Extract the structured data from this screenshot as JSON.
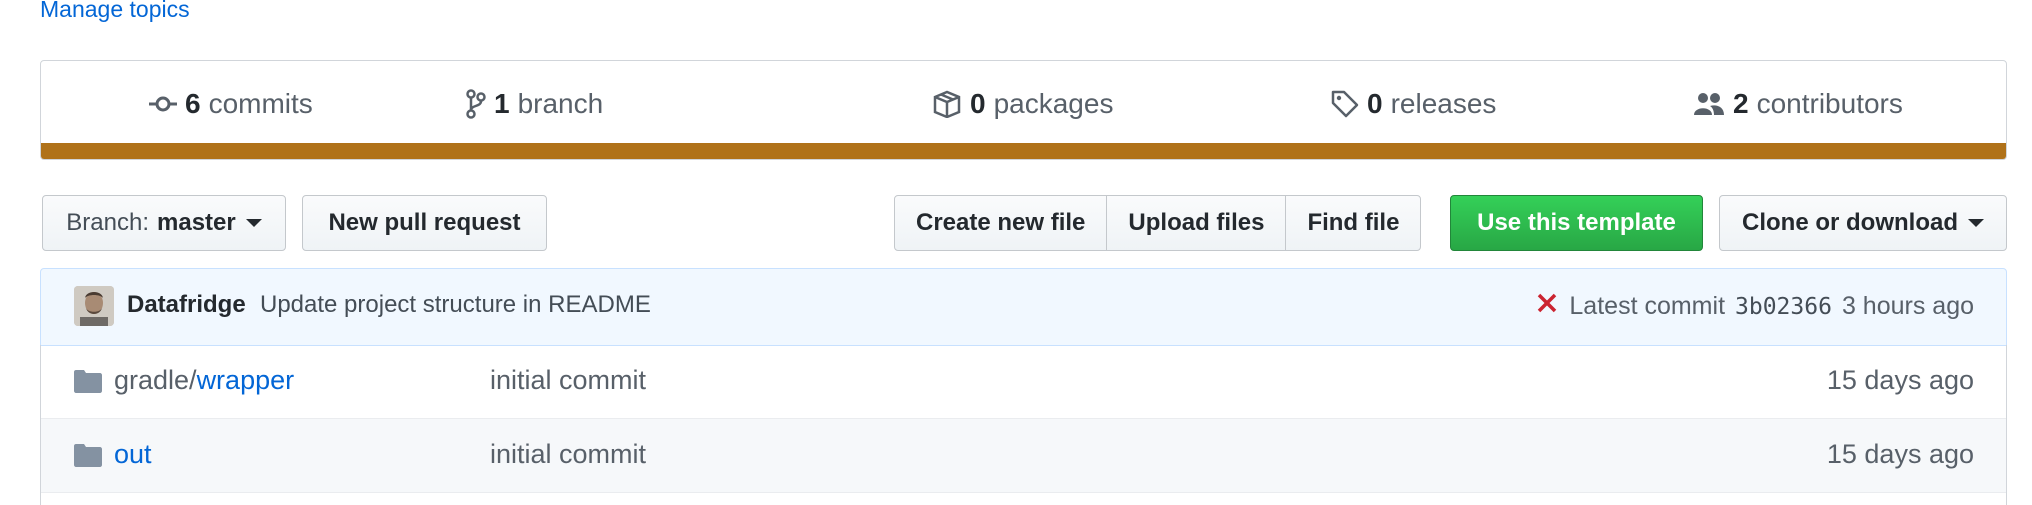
{
  "manage_topics": "Manage topics",
  "summary": {
    "commits": {
      "count": "6",
      "label": "commits"
    },
    "branch": {
      "count": "1",
      "label": "branch"
    },
    "packages": {
      "count": "0",
      "label": "packages"
    },
    "releases": {
      "count": "0",
      "label": "releases"
    },
    "contributors": {
      "count": "2",
      "label": "contributors"
    },
    "language_color": "#b07219"
  },
  "toolbar": {
    "branch_prefix": "Branch:",
    "branch_name": "master",
    "new_pull_request": "New pull request",
    "create_new_file": "Create new file",
    "upload_files": "Upload files",
    "find_file": "Find file",
    "use_template": "Use this template",
    "clone_download": "Clone or download"
  },
  "commit": {
    "author": "Datafridge",
    "message": "Update project structure in README",
    "status_icon": "x-icon",
    "latest_label": "Latest commit",
    "sha": "3b02366",
    "age": "3 hours ago"
  },
  "files": [
    {
      "prefix": "gradle/",
      "name": "wrapper",
      "message": "initial commit",
      "age": "15 days ago",
      "icon": "folder-icon"
    },
    {
      "prefix": "",
      "name": "out",
      "message": "initial commit",
      "age": "15 days ago",
      "icon": "folder-icon"
    }
  ]
}
